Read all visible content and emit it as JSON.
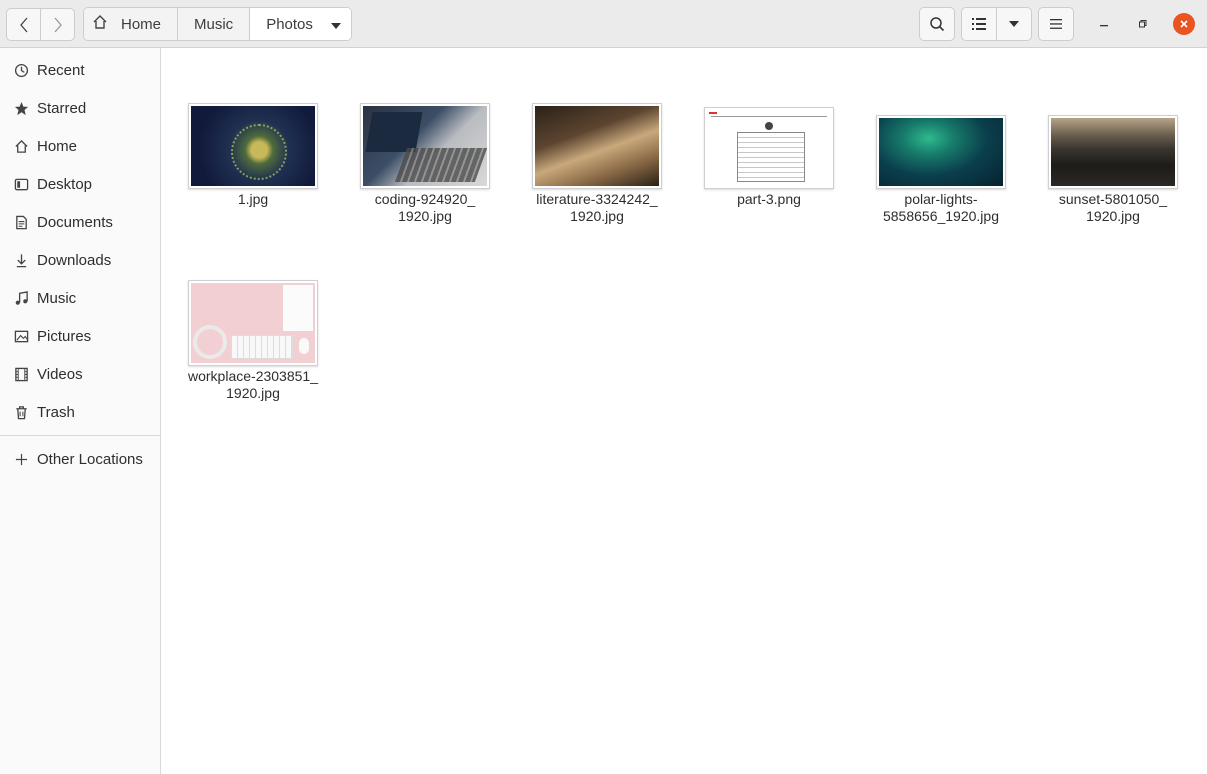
{
  "nav": {
    "back_icon": "chevron-left",
    "forward_icon": "chevron-right"
  },
  "pathbar": {
    "home_icon": "home",
    "crumbs": [
      "Home",
      "Music",
      "Photos"
    ],
    "dropdown_icon": "caret-down"
  },
  "toolbar": {
    "search_icon": "search",
    "view_icon": "list-view",
    "view_dropdown_icon": "caret-down",
    "menu_icon": "hamburger"
  },
  "window": {
    "minimize_icon": "minimize",
    "maximize_icon": "maximize",
    "close_icon": "close",
    "close_color": "#e95420"
  },
  "sidebar": {
    "items": [
      {
        "label": "Recent",
        "icon": "clock"
      },
      {
        "label": "Starred",
        "icon": "star"
      },
      {
        "label": "Home",
        "icon": "home"
      },
      {
        "label": "Desktop",
        "icon": "desktop"
      },
      {
        "label": "Documents",
        "icon": "document"
      },
      {
        "label": "Downloads",
        "icon": "download"
      },
      {
        "label": "Music",
        "icon": "music"
      },
      {
        "label": "Pictures",
        "icon": "picture"
      },
      {
        "label": "Videos",
        "icon": "video"
      },
      {
        "label": "Trash",
        "icon": "trash"
      }
    ],
    "other_locations": {
      "label": "Other Locations",
      "icon": "plus"
    }
  },
  "files": [
    {
      "name": "1.jpg"
    },
    {
      "name": "coding-924920_\n1920.jpg"
    },
    {
      "name": "literature-3324242_\n1920.jpg"
    },
    {
      "name": "part-3.png"
    },
    {
      "name": "polar-lights-\n5858656_1920.jpg"
    },
    {
      "name": "sunset-5801050_\n1920.jpg"
    },
    {
      "name": "workplace-2303851_\n1920.jpg"
    }
  ]
}
